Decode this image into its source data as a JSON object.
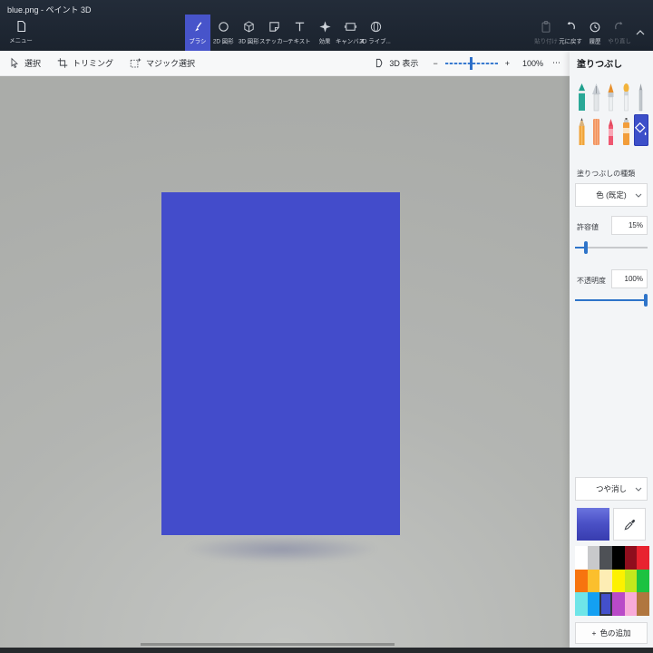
{
  "window": {
    "title": "blue.png - ペイント 3D"
  },
  "ribbon": {
    "menu": {
      "label": "メニュー",
      "icon": "menu-file-icon"
    },
    "tabs": [
      {
        "label": "ブラシ",
        "icon": "brush-icon",
        "selected": true
      },
      {
        "label": "2D 図形",
        "icon": "2d-shapes-icon",
        "selected": false
      },
      {
        "label": "3D 図形",
        "icon": "3d-shapes-icon",
        "selected": false
      },
      {
        "label": "ステッカー",
        "icon": "sticker-icon",
        "selected": false
      },
      {
        "label": "テキスト",
        "icon": "text-icon",
        "selected": false
      },
      {
        "label": "効果",
        "icon": "effects-icon",
        "selected": false
      },
      {
        "label": "キャンバス",
        "icon": "canvas-icon",
        "selected": false
      },
      {
        "label": "3D ライブ...",
        "icon": "3d-library-icon",
        "selected": false
      }
    ],
    "actions": [
      {
        "label": "貼り付け",
        "icon": "paste-icon",
        "enabled": false
      },
      {
        "label": "元に戻す",
        "icon": "undo-icon",
        "enabled": true
      },
      {
        "label": "履歴",
        "icon": "history-icon",
        "enabled": true
      },
      {
        "label": "やり直し",
        "icon": "redo-icon",
        "enabled": false
      }
    ],
    "collapse_icon": "chevron-up-icon"
  },
  "toolbar": {
    "select": "選択",
    "crop": "トリミング",
    "magic_select": "マジック選択",
    "view_3d": "3D 表示",
    "zoom_out": "−",
    "zoom_in": "+",
    "zoom_level": "100%",
    "more": "⋯"
  },
  "panel": {
    "title": "塗りつぶし",
    "tool_icons": [
      "marker-icon",
      "calligraphy-pen-icon",
      "oil-brush-icon",
      "watercolor-icon",
      "pixel-pen-icon",
      "pencil-icon",
      "eraser-icon",
      "crayon-icon",
      "spray-can-icon",
      "fill-bucket-icon"
    ],
    "selected_tool": "fill-bucket-icon",
    "fill_type": {
      "label": "塗りつぶしの種類",
      "value": "色 (既定)"
    },
    "tolerance": {
      "label": "許容値",
      "value": "15%",
      "percent": 15
    },
    "opacity": {
      "label": "不透明度",
      "value": "100%",
      "percent": 100
    },
    "finish": {
      "value": "つや消し"
    },
    "current_color_gradient": {
      "top": "#6b74de",
      "bottom": "#383daf"
    },
    "palette": [
      [
        "#ffffff",
        "#c8c9cb",
        "#4e5156",
        "#000000",
        "#8f0e1d",
        "#e8232f"
      ],
      [
        "#f7740f",
        "#fbbf2d",
        "#fdedb4",
        "#fdf100",
        "#c3e81c",
        "#1cc241"
      ],
      [
        "#6fe5e8",
        "#14a0f2",
        "#4350cb",
        "#b94ac8",
        "#f8abd9",
        "#b0763f"
      ]
    ],
    "selected_palette_cell": "row 3, col 3",
    "add_color": {
      "plus": "+",
      "label": "色の追加"
    }
  },
  "canvas": {
    "color": "#434ccb"
  },
  "accent": {
    "selected_tab_bg": "#4754ca",
    "slider_blue": "#2e74c9"
  }
}
